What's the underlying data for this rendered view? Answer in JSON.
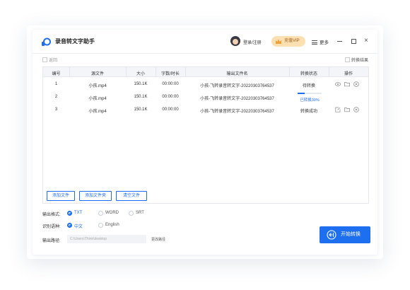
{
  "app": {
    "title": "录音转文字助手",
    "login_label": "登录/注册",
    "vip_label": "充值VIP",
    "more_label": "更多"
  },
  "toolbar": {
    "back_label": "返回",
    "result_label": "转换结果"
  },
  "table": {
    "headers": [
      "编号",
      "源文件",
      "大小",
      "字数/时长",
      "输出文件名",
      "转换状态",
      "操作"
    ],
    "rows": [
      {
        "index": "1",
        "source": "小孩.mp4",
        "size": "150.1K",
        "duration": "00:00:00",
        "output": "小孩-飞转录音转文字-20220303764537",
        "status": "待转换"
      },
      {
        "index": "2",
        "source": "小孩.mp4",
        "size": "150.1K",
        "duration": "00:00:00",
        "output": "小孩-飞转录音转文字-20220303764537",
        "status": "",
        "progress_label": "已转换30%",
        "progress_value": 0.3
      },
      {
        "index": "3",
        "source": "小孩.mp4",
        "size": "150.1K",
        "duration": "00:00:00",
        "output": "小孩-飞转录音转文字-20220303764537",
        "status": "转换成功"
      }
    ]
  },
  "buttons": {
    "add_file": "添加文件",
    "add_folder": "添加文件夹",
    "clear_files": "清空文件",
    "start": "开始转换"
  },
  "options": {
    "format_label": "输出格式:",
    "formats": [
      "TXT",
      "WORD",
      "SRT"
    ],
    "selected_format": "TXT",
    "language_label": "识别语种:",
    "languages": [
      "中文",
      "English"
    ],
    "selected_language": "中文",
    "path_label": "输出路径:",
    "path_value": "C:\\Users\\Think\\desktop",
    "change_path_label": "更改路径"
  },
  "colors": {
    "accent": "#1e6ff0",
    "vip_bg": "#fde0b2",
    "header_bg": "#f3f5f9"
  }
}
